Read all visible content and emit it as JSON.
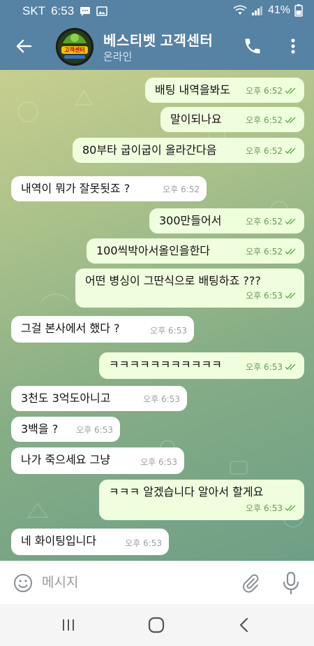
{
  "status_bar": {
    "carrier": "SKT",
    "time": "6:53",
    "battery": "41%"
  },
  "header": {
    "title": "베스티벳 고객센터",
    "status": "온라인",
    "avatar_text": "고객센터"
  },
  "messages": [
    {
      "dir": "out",
      "text": "배팅 내역을봐도",
      "time": "오후 6:52",
      "read": true
    },
    {
      "dir": "out",
      "text": "말이되나요",
      "time": "오후 6:52",
      "read": true
    },
    {
      "dir": "out",
      "text": "80부타 굽이굽이 올라간다음",
      "time": "오후 6:52",
      "read": true
    },
    {
      "dir": "in",
      "text": "내역이 뭐가 잘못됫죠 ?",
      "time": "오후 6:52"
    },
    {
      "dir": "out",
      "text": "300만들어서",
      "time": "오후 6:52",
      "read": true
    },
    {
      "dir": "out",
      "text": "100씩박아서올인을한다",
      "time": "오후 6:52",
      "read": true
    },
    {
      "dir": "out",
      "text": "어떤 병싱이 그딴식으로 배팅하죠 ???",
      "time": "오후 6:53",
      "read": true
    },
    {
      "dir": "in",
      "text": "그걸 본사에서 했다 ?",
      "time": "오후 6:53"
    },
    {
      "dir": "out",
      "text": "ㅋㅋㅋㅋㅋㅋㅋㅋㅋㅋㅋ",
      "time": "오후 6:53",
      "read": true
    },
    {
      "dir": "in",
      "text": "3천도 3억도아니고",
      "time": "오후 6:53"
    },
    {
      "dir": "in",
      "text": "3백을 ?",
      "time": "오후 6:53"
    },
    {
      "dir": "in",
      "text": "나가 죽으세요 그냥",
      "time": "오후 6:53"
    },
    {
      "dir": "out",
      "text": "ㅋㅋㅋ 알겠습니다 알아서 할게요",
      "time": "오후 6:53",
      "read": true
    },
    {
      "dir": "in",
      "text": "네 화이팅입니다",
      "time": "오후 6:53"
    }
  ],
  "input": {
    "placeholder": "메시지"
  },
  "colors": {
    "header_bg": "#5682a3",
    "outgoing_bubble": "#effedd",
    "incoming_bubble": "#ffffff",
    "read_check": "#5fa84d"
  },
  "icons": {
    "back": "arrow-left-icon",
    "call": "phone-icon",
    "menu": "more-vert-icon",
    "emoji": "emoji-icon",
    "attach": "paperclip-icon",
    "mic": "microphone-icon",
    "nav_recent": "recent-apps-icon",
    "nav_home": "home-icon",
    "nav_back": "nav-back-icon"
  }
}
